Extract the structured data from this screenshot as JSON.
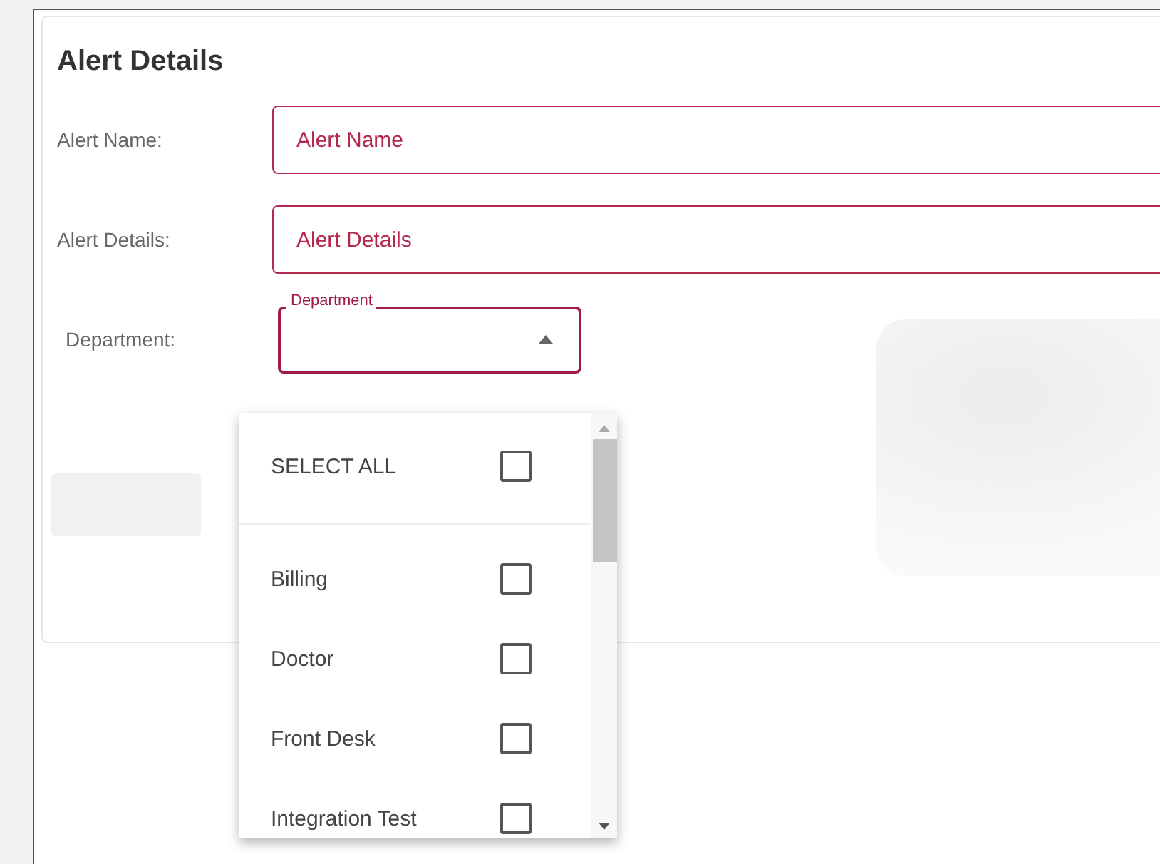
{
  "title": "Alert Details",
  "fields": [
    {
      "label": "Alert Name:",
      "placeholder": "Alert Name"
    },
    {
      "label": "Alert Details:",
      "placeholder": "Alert Details"
    }
  ],
  "department": {
    "label": "Department:",
    "floating_label": "Department",
    "expanded": true,
    "options": [
      {
        "label": "SELECT ALL",
        "kind": "select-all",
        "checked": false
      },
      {
        "label": "Billing",
        "kind": "option",
        "checked": false
      },
      {
        "label": "Doctor",
        "kind": "option",
        "checked": false
      },
      {
        "label": "Front Desk",
        "kind": "option",
        "checked": false
      },
      {
        "label": "Integration Test",
        "kind": "option",
        "checked": false
      }
    ]
  }
}
